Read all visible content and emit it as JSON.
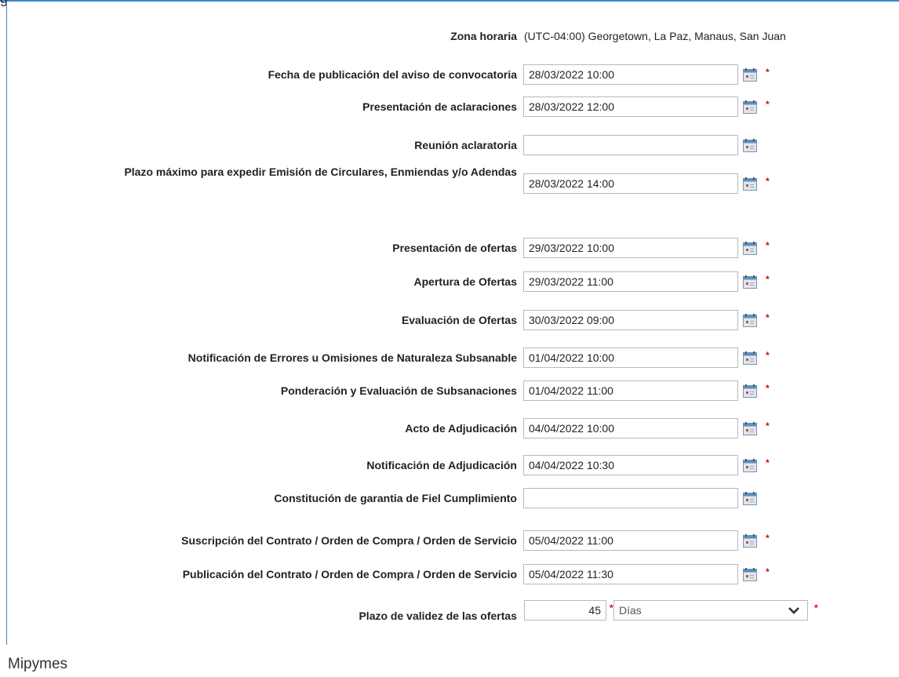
{
  "header": {
    "title_fragment": "g"
  },
  "timezone": {
    "label": "Zona horaria",
    "value": "(UTC-04:00) Georgetown, La Paz, Manaus, San Juan"
  },
  "required_mark": "*",
  "schedule": [
    {
      "label": "Fecha de publicación del aviso de convocatoria",
      "value": "28/03/2022 10:00",
      "required": true
    },
    {
      "label": "Presentación de aclaraciones",
      "value": "28/03/2022 12:00",
      "required": true
    },
    {
      "label": "Reunión aclaratoria",
      "value": "",
      "required": false
    },
    {
      "label": "Plazo máximo para expedir Emisión de Circulares, Enmiendas y/o Adendas",
      "value": "28/03/2022 14:00",
      "required": true
    },
    {
      "label": "Presentación de ofertas",
      "value": "29/03/2022 10:00",
      "required": true
    },
    {
      "label": "Apertura de Ofertas",
      "value": "29/03/2022 11:00",
      "required": true
    },
    {
      "label": "Evaluación de Ofertas",
      "value": "30/03/2022 09:00",
      "required": true
    },
    {
      "label": "Notificación de Errores u Omisiones de Naturaleza Subsanable",
      "value": "01/04/2022 10:00",
      "required": true
    },
    {
      "label": "Ponderación y Evaluación de Subsanaciones",
      "value": "01/04/2022 11:00",
      "required": true
    },
    {
      "label": "Acto de Adjudicación",
      "value": "04/04/2022 10:00",
      "required": true
    },
    {
      "label": "Notificación de Adjudicación",
      "value": "04/04/2022 10:30",
      "required": true
    },
    {
      "label": "Constitución de garantia de Fiel Cumplimiento",
      "value": "",
      "required": false
    },
    {
      "label": "Suscripción del Contrato / Orden de Compra / Orden de Servicio",
      "value": "05/04/2022 11:00",
      "required": true
    },
    {
      "label": "Publicación del Contrato / Orden de Compra / Orden de Servicio",
      "value": "05/04/2022 11:30",
      "required": true
    }
  ],
  "validity": {
    "label": "Plazo de validez de las ofertas",
    "amount": "45",
    "unit": "Días"
  },
  "section_mipymes": {
    "title": "Mipymes"
  },
  "colors": {
    "accent": "#3a86c8",
    "required": "#e0001b"
  },
  "icons": {
    "calendar": "calendar-icon",
    "dropdown": "chevron-down-icon"
  }
}
